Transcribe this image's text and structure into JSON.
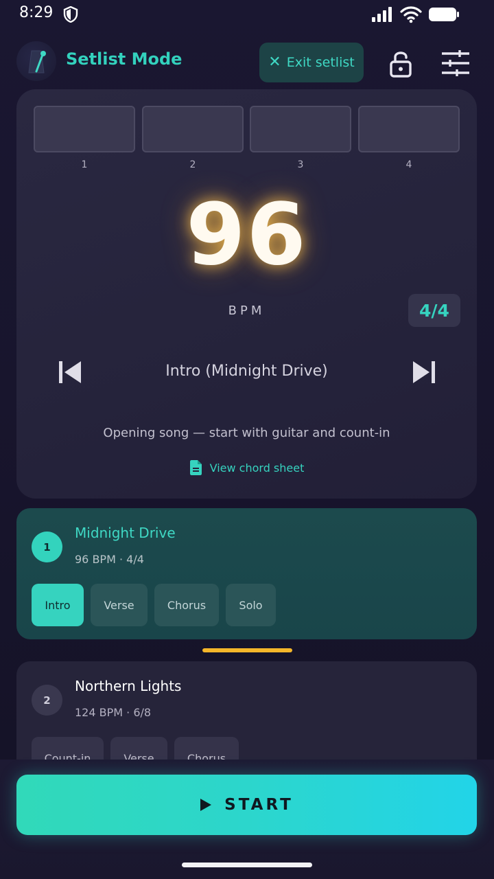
{
  "status": {
    "time": "8:29",
    "icons": [
      "shield-icon",
      "signal-icon",
      "wifi-icon",
      "battery-icon"
    ]
  },
  "header": {
    "title": "Setlist Mode",
    "exit_label": "Exit setlist",
    "icons": [
      "metronome-icon",
      "close-icon",
      "lock-icon",
      "tune-icon"
    ]
  },
  "beats": [
    "1",
    "2",
    "3",
    "4"
  ],
  "tempo": {
    "bpm": "96",
    "unit": "BPM",
    "time_signature": "4/4"
  },
  "section": {
    "name": "Intro (Midnight Drive)",
    "note": "Opening song — start with guitar and count-in",
    "chord_link": "View chord sheet"
  },
  "songs": [
    {
      "number": "1",
      "title": "Midnight Drive",
      "meta": "96 BPM · 4/4",
      "sections": [
        "Intro",
        "Verse",
        "Chorus",
        "Solo"
      ],
      "selected_section": "Intro"
    },
    {
      "number": "2",
      "title": "Northern Lights",
      "meta": "124 BPM · 6/8",
      "sections": [
        "Count-in",
        "Verse",
        "Chorus"
      ]
    }
  ],
  "start_label": "START",
  "colors": {
    "accent": "#36d3bf",
    "glow": "#ffc450",
    "indicator": "#f4b62a",
    "background": "#18152d"
  }
}
